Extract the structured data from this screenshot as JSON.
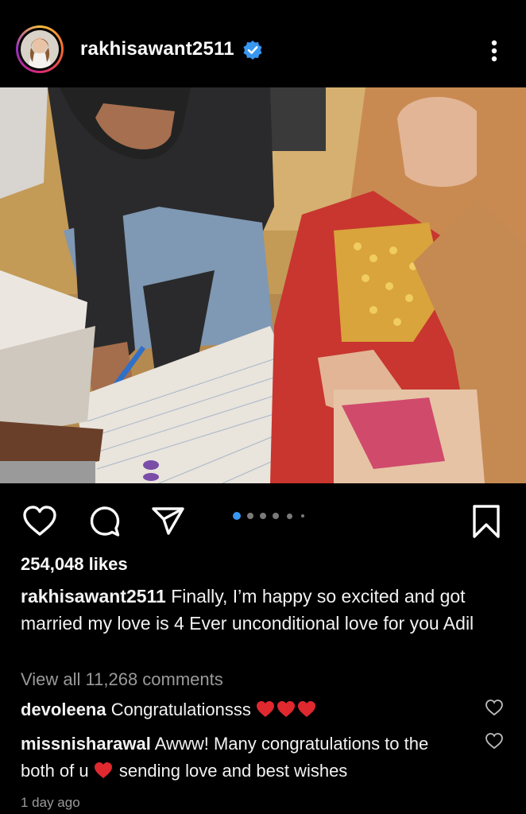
{
  "post": {
    "username": "rakhisawant2511",
    "verified": true,
    "likes": "254,048 likes",
    "caption_user": "rakhisawant2511",
    "caption_text": "Finally, I’m happy so excited and got married my love is 4 Ever unconditional love for you Adil",
    "view_all": "View all 11,268 comments",
    "time": "1 day ago",
    "carousel": {
      "count": 6,
      "active_index": 0
    }
  },
  "comments": [
    {
      "user": "devoleena",
      "text": "Congratulationsss",
      "emoji": "red-heart x3"
    },
    {
      "user": "missnisharawal",
      "text_before": "Awww! Many congratulations to the both of u",
      "text_after": "sending love and best wishes",
      "emoji": "red-heart"
    }
  ],
  "icons": [
    "avatar",
    "verified-badge-icon",
    "more-options-icon",
    "like-heart-icon",
    "comment-icon",
    "share-icon",
    "save-bookmark-icon",
    "comment-like-icon"
  ],
  "colors": {
    "background": "#000000",
    "verified": "#3897f0",
    "carousel_active": "#3897f0",
    "heart": "#e0282f"
  }
}
